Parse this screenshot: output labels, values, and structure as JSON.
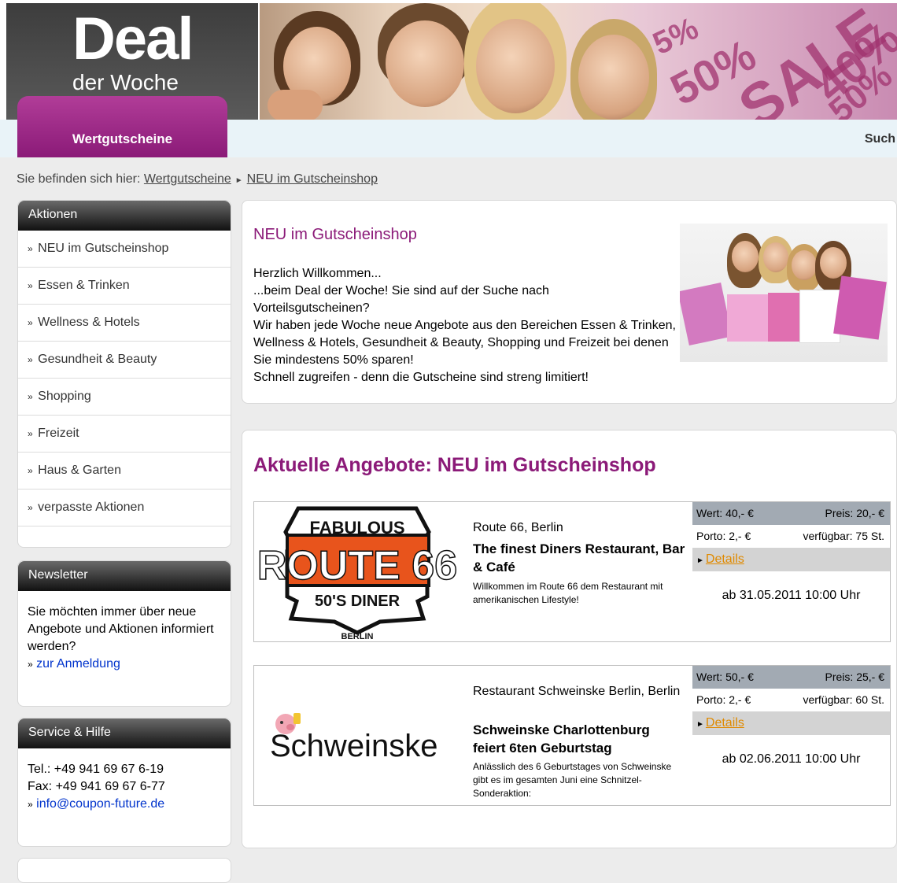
{
  "logo": {
    "line1": "Deal",
    "line2": "der Woche"
  },
  "hero": {
    "sale_bits": [
      "5%",
      "50%",
      "SALE",
      "40%",
      "50%"
    ]
  },
  "nav": {
    "tab_label": "Wertgutscheine",
    "search_label": "Such"
  },
  "breadcrumb": {
    "prefix": "Sie befinden sich hier:",
    "items": [
      "Wertgutscheine",
      "NEU im Gutscheinshop"
    ]
  },
  "sidebar": {
    "aktionen": {
      "title": "Aktionen",
      "items": [
        "NEU im Gutscheinshop",
        "Essen & Trinken",
        "Wellness & Hotels",
        "Gesundheit & Beauty",
        "Shopping",
        "Freizeit",
        "Haus & Garten",
        "verpasste Aktionen"
      ]
    },
    "newsletter": {
      "title": "Newsletter",
      "text": "Sie möchten immer über neue Angebote und Aktionen informiert werden?",
      "link": "zur Anmeldung"
    },
    "service": {
      "title": "Service & Hilfe",
      "tel": "Tel.: +49 941 69 67 6-19",
      "fax": "Fax: +49 941 69 67 6-77",
      "email": "info@coupon-future.de"
    }
  },
  "intro": {
    "title": "NEU im Gutscheinshop",
    "lines": [
      "Herzlich Willkommen...",
      "...beim Deal der Woche! Sie sind auf der Suche nach Vorteilsgutscheinen?",
      "Wir haben jede Woche neue Angebote aus den Bereichen Essen & Trinken, Wellness & Hotels, Gesundheit & Beauty, Shopping und Freizeit bei denen Sie mindestens 50% sparen!",
      "Schnell zugreifen - denn die Gutscheine sind streng limitiert!"
    ]
  },
  "offers": {
    "title": "Aktuelle Angebote: NEU im Gutscheinshop",
    "items": [
      {
        "logo": {
          "top": "FABULOUS",
          "main": "ROUTE 66",
          "sub": "50'S DINER",
          "city": "BERLIN"
        },
        "location": "Route 66, Berlin",
        "title": "The finest Diners Restaurant, Bar & Café",
        "desc": "Willkommen im Route 66 dem Restaurant mit amerikanischen Lifestyle!",
        "wert": "Wert: 40,- €",
        "preis": "Preis: 20,- €",
        "porto": "Porto: 2,- €",
        "verfuegbar": "verfügbar: 75 St.",
        "details": "Details",
        "date": "ab 31.05.2011 10:00 Uhr"
      },
      {
        "logo": {
          "main": "Schweinske"
        },
        "location": "Restaurant Schweinske Berlin, Berlin",
        "title": "Schweinske Charlottenburg feiert 6ten Geburtstag",
        "desc": "Anlässlich des 6 Geburtstages von Schweinske gibt es im gesamten Juni eine Schnitzel-Sonderaktion:",
        "wert": "Wert: 50,- €",
        "preis": "Preis: 25,- €",
        "porto": "Porto: 2,- €",
        "verfuegbar": "verfügbar: 60 St.",
        "details": "Details",
        "date": "ab 02.06.2011 10:00 Uhr"
      }
    ]
  },
  "colors": {
    "brand_purple": "#8b1a78",
    "details_orange": "#e08a00",
    "link_blue": "#0033cc"
  }
}
